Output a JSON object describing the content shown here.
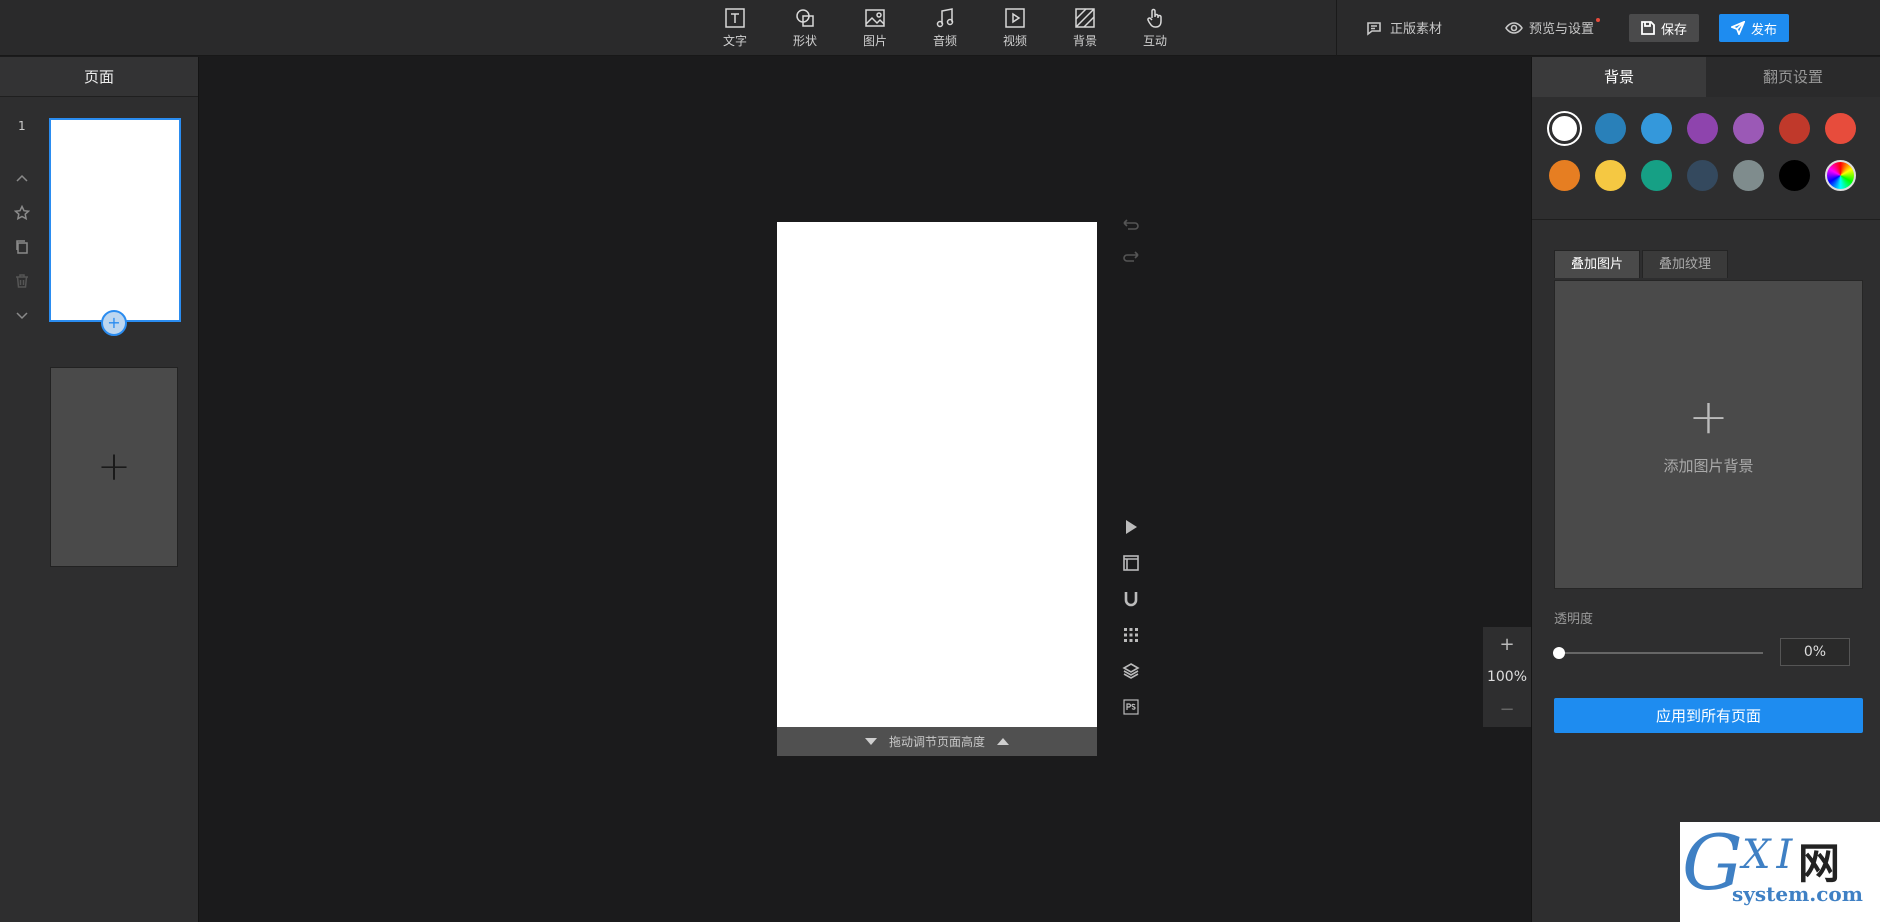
{
  "toolbar": {
    "tools": [
      {
        "label": "文字",
        "icon": "text-icon"
      },
      {
        "label": "形状",
        "icon": "shape-icon"
      },
      {
        "label": "图片",
        "icon": "image-icon"
      },
      {
        "label": "音频",
        "icon": "music-icon"
      },
      {
        "label": "视频",
        "icon": "video-icon"
      },
      {
        "label": "背景",
        "icon": "background-icon"
      },
      {
        "label": "互动",
        "icon": "hand-pointer-icon"
      }
    ],
    "licensed_assets": "正版素材",
    "preview_settings": "预览与设置",
    "save": "保存",
    "publish": "发布"
  },
  "left_panel": {
    "title": "页面",
    "pages": [
      {
        "number": "1"
      }
    ],
    "add_page_symbol": "+"
  },
  "canvas": {
    "footer_hint": "拖动调节页面高度",
    "zoom": "100%",
    "zoom_in": "+",
    "zoom_out": "−"
  },
  "right_panel": {
    "tabs": [
      {
        "label": "背景",
        "active": true
      },
      {
        "label": "翻页设置",
        "active": false
      }
    ],
    "colors": [
      "#ffffff",
      "#2980b9",
      "#3498db",
      "#8e44ad",
      "#9b59b6",
      "#c0392b",
      "#e74c3c",
      "#e67e22",
      "#f5c842",
      "#16a085",
      "#34495e",
      "#7f8c8d",
      "#000000",
      "rainbow"
    ],
    "selected_color": "#ffffff",
    "subtabs": [
      {
        "label": "叠加图片",
        "active": true
      },
      {
        "label": "叠加纹理",
        "active": false
      }
    ],
    "add_image_label": "添加图片背景",
    "opacity_label": "透明度",
    "opacity_value": "0%",
    "opacity_fraction": 0,
    "apply_all": "应用到所有页面"
  },
  "watermark": {
    "g": "G",
    "xi": "XI",
    "wang": "网",
    "site": "system.com"
  }
}
